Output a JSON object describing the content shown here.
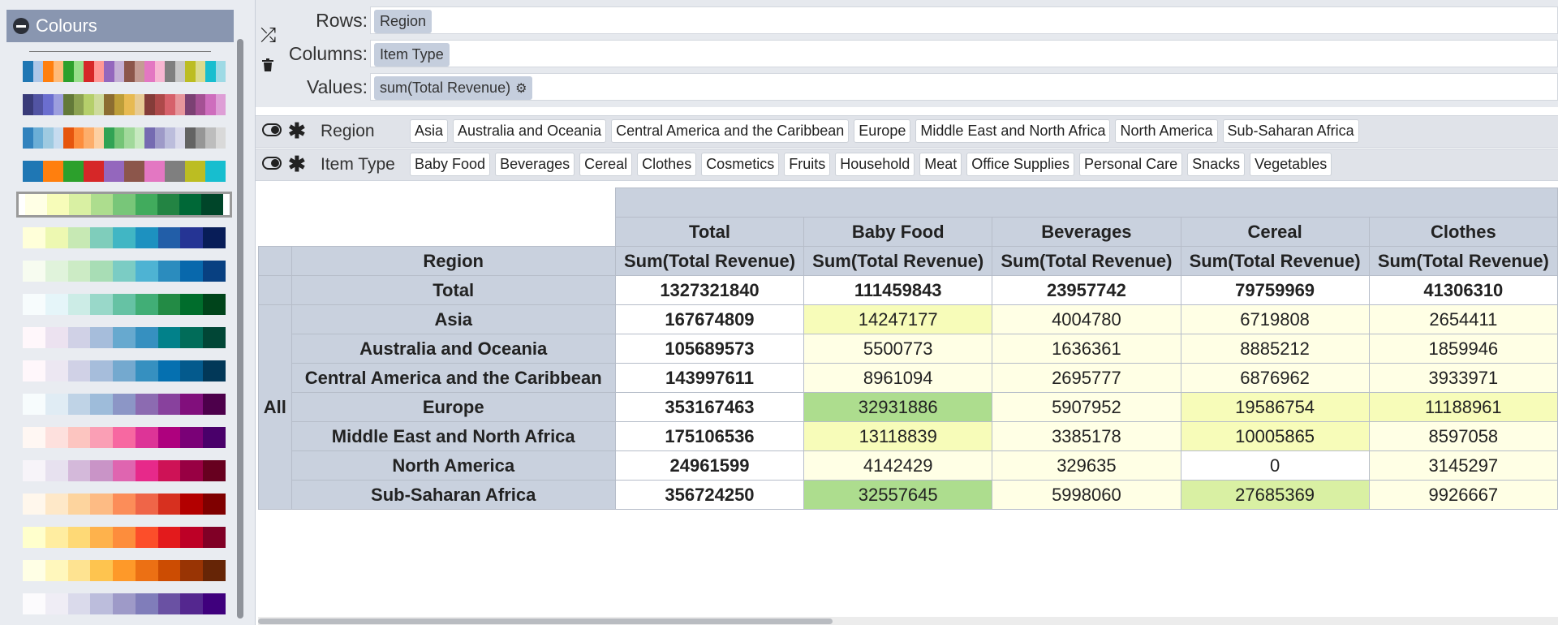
{
  "colours_panel": {
    "title": "Colours",
    "palettes": [
      {
        "colors": [
          "#1f77b4",
          "#aec7e8",
          "#ff7f0e",
          "#ffbb78",
          "#2ca02c",
          "#98df8a",
          "#d62728",
          "#ff9896",
          "#9467bd",
          "#c5b0d5",
          "#8c564b",
          "#c49c94",
          "#e377c2",
          "#f7b6d2",
          "#7f7f7f",
          "#c7c7c7",
          "#bcbd22",
          "#dbdb8d",
          "#17becf",
          "#9edae5"
        ]
      },
      {
        "colors": [
          "#393b79",
          "#5254a3",
          "#6b6ecf",
          "#9c9ede",
          "#637939",
          "#8ca252",
          "#b5cf6b",
          "#cedb9c",
          "#8c6d31",
          "#bd9e39",
          "#e7ba52",
          "#e7cb94",
          "#843c39",
          "#ad494a",
          "#d6616b",
          "#e7969c",
          "#7b4173",
          "#a55194",
          "#ce6dbd",
          "#de9ed6"
        ]
      },
      {
        "colors": [
          "#3182bd",
          "#6baed6",
          "#9ecae1",
          "#c6dbef",
          "#e6550d",
          "#fd8d3c",
          "#fdae6b",
          "#fdd0a2",
          "#31a354",
          "#74c476",
          "#a1d99b",
          "#c7e9c0",
          "#756bb1",
          "#9e9ac8",
          "#bcbddc",
          "#dadaeb",
          "#636363",
          "#969696",
          "#bdbdbd",
          "#d9d9d9"
        ]
      },
      {
        "colors": [
          "#1f77b4",
          "#ff7f0e",
          "#2ca02c",
          "#d62728",
          "#9467bd",
          "#8c564b",
          "#e377c2",
          "#7f7f7f",
          "#bcbd22",
          "#17becf"
        ]
      },
      {
        "colors": [
          "#ffffe5",
          "#f7fcb9",
          "#d9f0a3",
          "#addd8e",
          "#78c679",
          "#41ab5d",
          "#238443",
          "#006837",
          "#004529"
        ]
      },
      {
        "colors": [
          "#ffffd9",
          "#edf8b1",
          "#c7e9b4",
          "#7fcdbb",
          "#41b6c4",
          "#1d91c0",
          "#225ea8",
          "#253494",
          "#081d58"
        ]
      },
      {
        "colors": [
          "#f7fcf0",
          "#e0f3db",
          "#ccebc5",
          "#a8ddb5",
          "#7bccc4",
          "#4eb3d3",
          "#2b8cbe",
          "#0868ac",
          "#084081"
        ]
      },
      {
        "colors": [
          "#f7fcfd",
          "#e5f5f9",
          "#ccece6",
          "#99d8c9",
          "#66c2a4",
          "#41ae76",
          "#238b45",
          "#006d2c",
          "#00441b"
        ]
      },
      {
        "colors": [
          "#fff7fb",
          "#ece2f0",
          "#d0d1e6",
          "#a6bddb",
          "#67a9cf",
          "#3690c0",
          "#02818a",
          "#016c59",
          "#014636"
        ]
      },
      {
        "colors": [
          "#fff7fb",
          "#ece7f2",
          "#d0d1e6",
          "#a6bddb",
          "#74a9cf",
          "#3690c0",
          "#0570b0",
          "#045a8d",
          "#023858"
        ]
      },
      {
        "colors": [
          "#f7fcfd",
          "#e0ecf4",
          "#bfd3e6",
          "#9ebcda",
          "#8c96c6",
          "#8c6bb1",
          "#88419d",
          "#810f7c",
          "#4d004b"
        ]
      },
      {
        "colors": [
          "#fff7f3",
          "#fde0dd",
          "#fcc5c0",
          "#fa9fb5",
          "#f768a1",
          "#dd3497",
          "#ae017e",
          "#7a0177",
          "#49006a"
        ]
      },
      {
        "colors": [
          "#f7f4f9",
          "#e7e1ef",
          "#d4b9da",
          "#c994c7",
          "#df65b0",
          "#e7298a",
          "#ce1256",
          "#980043",
          "#67001f"
        ]
      },
      {
        "colors": [
          "#fff7ec",
          "#fee8c8",
          "#fdd49e",
          "#fdbb84",
          "#fc8d59",
          "#ef6548",
          "#d7301f",
          "#b30000",
          "#7f0000"
        ]
      },
      {
        "colors": [
          "#ffffcc",
          "#ffeda0",
          "#fed976",
          "#feb24c",
          "#fd8d3c",
          "#fc4e2a",
          "#e31a1c",
          "#bd0026",
          "#800026"
        ]
      },
      {
        "colors": [
          "#ffffe5",
          "#fff7bc",
          "#fee391",
          "#fec44f",
          "#fe9929",
          "#ec7014",
          "#cc4c02",
          "#993404",
          "#662506"
        ]
      },
      {
        "colors": [
          "#fcfbfd",
          "#efedf5",
          "#dadaeb",
          "#bcbddc",
          "#9e9ac8",
          "#807dba",
          "#6a51a3",
          "#54278f",
          "#3f007d"
        ]
      }
    ]
  },
  "shelf": {
    "rows_label": "Rows:",
    "rows_pill": "Region",
    "columns_label": "Columns:",
    "columns_pill": "Item Type",
    "values_label": "Values:",
    "values_pill": "sum(Total Revenue)"
  },
  "filters": {
    "region": {
      "name": "Region",
      "values": [
        "Asia",
        "Australia and Oceania",
        "Central America and the Caribbean",
        "Europe",
        "Middle East and North Africa",
        "North America",
        "Sub-Saharan Africa"
      ]
    },
    "item_type": {
      "name": "Item Type",
      "values": [
        "Baby Food",
        "Beverages",
        "Cereal",
        "Clothes",
        "Cosmetics",
        "Fruits",
        "Household",
        "Meat",
        "Office Supplies",
        "Personal Care",
        "Snacks",
        "Vegetables"
      ]
    }
  },
  "pivot": {
    "row_field": "Region",
    "measure": "Sum(Total Revenue)",
    "all_label": "All",
    "total_label": "Total",
    "columns": [
      "Total",
      "Baby Food",
      "Beverages",
      "Cereal",
      "Clothes"
    ],
    "rows": [
      {
        "label": "Total",
        "values": [
          "1327321840",
          "111459843",
          "23957742",
          "79759969",
          "41306310"
        ],
        "colors": [
          "#ffffff",
          "#ffffff",
          "#ffffff",
          "#ffffff",
          "#ffffff"
        ],
        "total": true
      },
      {
        "label": "Asia",
        "values": [
          "167674809",
          "14247177",
          "4004780",
          "6719808",
          "2654411"
        ],
        "colors": [
          "#ffffff",
          "#f7fcb9",
          "#ffffe5",
          "#ffffe5",
          "#ffffe5"
        ]
      },
      {
        "label": "Australia and Oceania",
        "values": [
          "105689573",
          "5500773",
          "1636361",
          "8885212",
          "1859946"
        ],
        "colors": [
          "#ffffff",
          "#ffffe5",
          "#ffffe5",
          "#ffffe5",
          "#ffffe5"
        ]
      },
      {
        "label": "Central America and the Caribbean",
        "values": [
          "143997611",
          "8961094",
          "2695777",
          "6876962",
          "3933971"
        ],
        "colors": [
          "#ffffff",
          "#ffffe5",
          "#ffffe5",
          "#ffffe5",
          "#ffffe5"
        ]
      },
      {
        "label": "Europe",
        "values": [
          "353167463",
          "32931886",
          "5907952",
          "19586754",
          "11188961"
        ],
        "colors": [
          "#ffffff",
          "#addd8e",
          "#ffffe5",
          "#f7fcb9",
          "#f7fcb9"
        ]
      },
      {
        "label": "Middle East and North Africa",
        "values": [
          "175106536",
          "13118839",
          "3385178",
          "10005865",
          "8597058"
        ],
        "colors": [
          "#ffffff",
          "#f7fcb9",
          "#ffffe5",
          "#f7fcb9",
          "#ffffe5"
        ]
      },
      {
        "label": "North America",
        "values": [
          "24961599",
          "4142429",
          "329635",
          "0",
          "3145297"
        ],
        "colors": [
          "#ffffff",
          "#ffffe5",
          "#ffffe5",
          "#ffffff",
          "#ffffe5"
        ]
      },
      {
        "label": "Sub-Saharan Africa",
        "values": [
          "356724250",
          "32557645",
          "5998060",
          "27685369",
          "9926667"
        ],
        "colors": [
          "#ffffff",
          "#addd8e",
          "#ffffe5",
          "#d9f0a3",
          "#ffffe5"
        ]
      }
    ]
  }
}
